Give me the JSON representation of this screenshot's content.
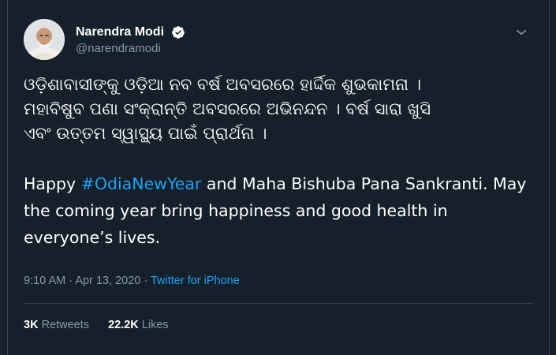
{
  "tweet": {
    "author": {
      "display_name": "Narendra Modi",
      "handle": "@narendramodi",
      "verified": true,
      "avatar_icon": "profile-photo"
    },
    "odia_lines": [
      "ଓଡ଼ିଶାବାସୀଙ୍କୁ ଓଡ଼ିଆ ନବ ବର୍ଷ ଅବସରରେ ହାର୍ଦ୍ଦିକ ଶୁଭକାମନା ।",
      "ମହାବିଷୁବ ପଣା ସଂକ୍ରାନ୍ତି ଅବସରରେ ଅଭିନନ୍ଦନ । ବର୍ଷ ସାରା ଖୁସି",
      "ଏବଂ ଉତ୍ତମ ସ୍ୱାସ୍ଥ୍ୟ ପାଇଁ ପ୍ରାର୍ଥନା ।"
    ],
    "english": {
      "prefix": "Happy ",
      "hashtag": "#OdiaNewYear",
      "suffix": " and Maha Bishuba Pana Sankranti. May the coming year bring happiness and good health in everyone’s lives."
    },
    "meta": {
      "time": "9:10 AM",
      "date": "Apr 13, 2020",
      "separator": " · ",
      "source": "Twitter for iPhone"
    },
    "stats": {
      "retweets_count": "3K",
      "retweets_label": "Retweets",
      "likes_count": "22.2K",
      "likes_label": "Likes"
    }
  },
  "colors": {
    "background": "#15202b",
    "accent": "#1da1f2",
    "secondary_text": "#8899a6",
    "border": "#38444d"
  }
}
